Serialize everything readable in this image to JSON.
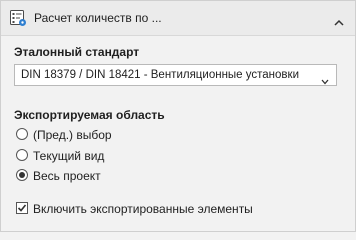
{
  "header": {
    "title": "Расчет количеств по ...",
    "icon": "list-settings-icon",
    "collapse_icon": "chevron-up-icon"
  },
  "standard": {
    "label": "Эталонный стандарт",
    "selected": "DIN 18379 / DIN 18421 - Вентиляционные установки"
  },
  "export_area": {
    "label": "Экспортируемая область",
    "options": [
      {
        "label": "(Пред.) выбор",
        "selected": false
      },
      {
        "label": "Текущий вид",
        "selected": false
      },
      {
        "label": "Весь проект",
        "selected": true
      }
    ]
  },
  "include_exported": {
    "label": "Включить экспортированные элементы",
    "checked": true
  }
}
